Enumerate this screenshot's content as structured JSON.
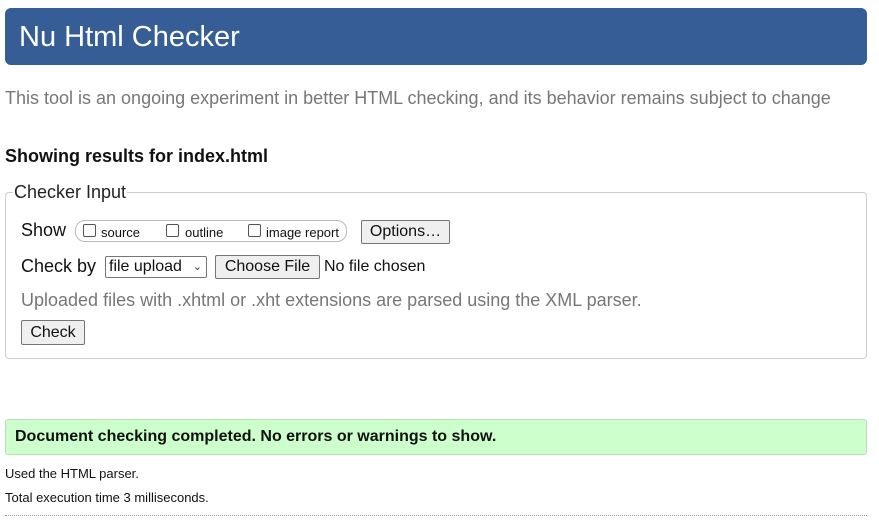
{
  "header": {
    "title": "Nu Html Checker"
  },
  "intro_text": "This tool is an ongoing experiment in better HTML checking, and its behavior remains subject to change",
  "results_heading": "Showing results for index.html",
  "checker_input": {
    "legend": "Checker Input",
    "show_label": "Show",
    "show_options": [
      {
        "label": "source",
        "checked": false
      },
      {
        "label": "outline",
        "checked": false
      },
      {
        "label": "image report",
        "checked": false
      }
    ],
    "options_button": "Options…",
    "check_by_label": "Check by",
    "check_by_selected": "file upload",
    "choose_file_button": "Choose File",
    "file_status": "No file chosen",
    "hint": "Uploaded files with .xhtml or .xht extensions are parsed using the XML parser.",
    "check_button": "Check"
  },
  "result": {
    "success_message": "Document checking completed. No errors or warnings to show.",
    "parser_note": "Used the HTML parser.",
    "execution_time": "Total execution time 3 milliseconds."
  },
  "colors": {
    "header_bg": "#365d95",
    "success_bg": "#ccffcc",
    "muted_text": "#777777"
  }
}
